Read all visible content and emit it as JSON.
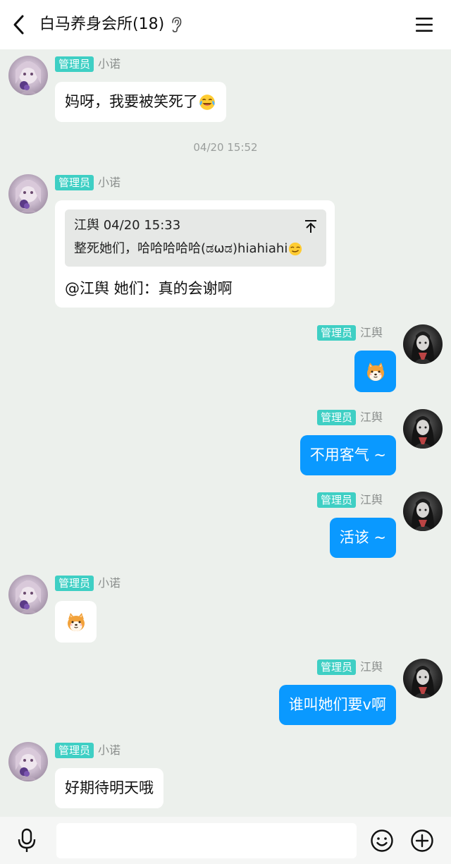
{
  "header": {
    "title": "白马养身会所(18)"
  },
  "badge_label": "管理员",
  "messages": [
    {
      "sender": "小诺",
      "side": "left",
      "text": "妈呀，我要被笑死了"
    },
    {
      "timestamp": "04/20 15:52"
    },
    {
      "sender": "小诺",
      "side": "left",
      "quote": {
        "head": "江舆 04/20 15:33",
        "text": "整死她们，哈哈哈哈哈(ಡωಡ)hiahiahi"
      },
      "text": "@江舆 她们：真的会谢啊"
    },
    {
      "sender": "江舆",
      "side": "right",
      "sticker": "shiba-dog-emoji"
    },
    {
      "sender": "江舆",
      "side": "right",
      "text": "不用客气 ~"
    },
    {
      "sender": "江舆",
      "side": "right",
      "text": "活该 ~"
    },
    {
      "sender": "小诺",
      "side": "left",
      "sticker": "shiba-dog-emoji"
    },
    {
      "sender": "江舆",
      "side": "right",
      "text": "谁叫她们要v啊"
    },
    {
      "sender": "小诺",
      "side": "left",
      "text": "好期待明天哦"
    }
  ],
  "input": {
    "placeholder": ""
  },
  "colors": {
    "background": "#ecf0ec",
    "outgoing_bubble": "#0a99ff",
    "admin_badge": "#3fcfc4"
  },
  "icons": [
    "back-arrow-icon",
    "ear-icon",
    "hamburger-menu-icon",
    "pin-top-icon",
    "microphone-icon",
    "smiley-icon",
    "plus-icon"
  ]
}
